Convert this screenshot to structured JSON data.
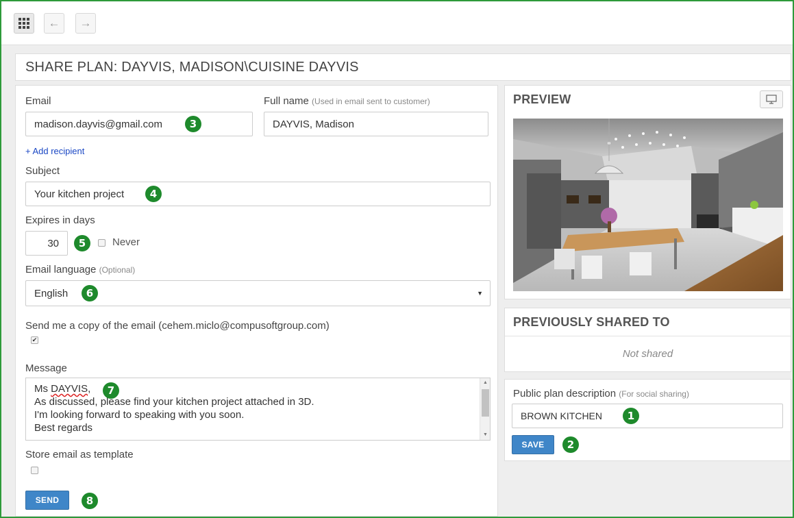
{
  "toolbar": {
    "apps_icon": "grid-icon",
    "back_symbol": "←",
    "forward_symbol": "→"
  },
  "title": "SHARE PLAN: DAYVIS, MADISON\\CUISINE DAYVIS",
  "form": {
    "email_label": "Email",
    "email_value": "madison.dayvis@gmail.com",
    "fullname_label": "Full name",
    "fullname_hint": "(Used in email sent to customer)",
    "fullname_value": "DAYVIS, Madison",
    "add_recipient": "+ Add recipient",
    "subject_label": "Subject",
    "subject_value": "Your kitchen project",
    "expires_label": "Expires in days",
    "expires_value": "30",
    "never_label": "Never",
    "language_label": "Email language",
    "language_hint": "(Optional)",
    "language_value": "English",
    "copy_label": "Send me a copy of the email (cehem.miclo@compusoftgroup.com)",
    "copy_checked": true,
    "message_label": "Message",
    "message_lines": [
      "Ms DAYVIS,",
      "As discussed, please find your kitchen project attached in 3D.",
      "I'm looking forward to speaking with you soon.",
      "Best regards"
    ],
    "template_label": "Store email as template",
    "template_checked": false,
    "send_label": "SEND"
  },
  "preview": {
    "title": "PREVIEW",
    "monitor_icon": "monitor-icon"
  },
  "shared": {
    "title": "PREVIOUSLY SHARED TO",
    "empty_text": "Not shared"
  },
  "public": {
    "label": "Public plan description",
    "hint": "(For social sharing)",
    "value": "BROWN KITCHEN",
    "save_label": "SAVE"
  },
  "callouts": [
    "1",
    "2",
    "3",
    "4",
    "5",
    "6",
    "7",
    "8"
  ],
  "colors": {
    "accent_green": "#1e8a2c",
    "button_blue": "#3f86c8",
    "frame_green": "#2e9a3a"
  }
}
